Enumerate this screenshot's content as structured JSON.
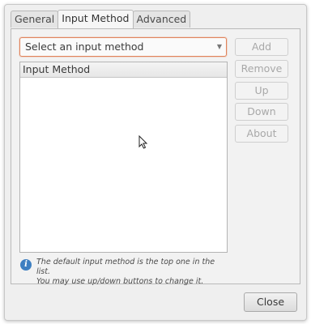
{
  "tabs": [
    {
      "label": "General",
      "active": false
    },
    {
      "label": "Input Method",
      "active": true
    },
    {
      "label": "Advanced",
      "active": false
    }
  ],
  "combo": {
    "value": "Select an input method"
  },
  "list": {
    "header": "Input Method",
    "items": []
  },
  "buttons": {
    "add": "Add",
    "remove": "Remove",
    "up": "Up",
    "down": "Down",
    "about": "About"
  },
  "info": {
    "line1": "The default input method is the top one in the list.",
    "line2": "You may use up/down buttons to change it.",
    "icon": "info-icon"
  },
  "footer": {
    "close": "Close"
  },
  "colors": {
    "focus_border": "#e0845c",
    "info_icon": "#3d7fc1"
  }
}
